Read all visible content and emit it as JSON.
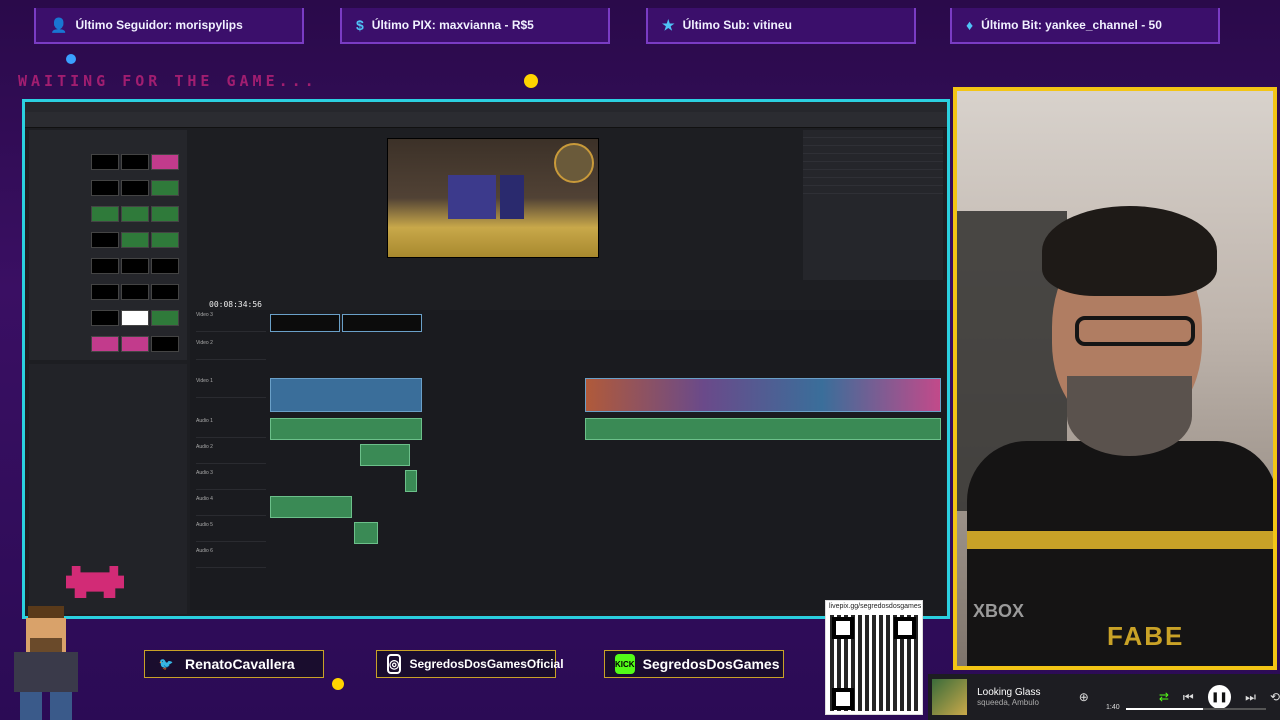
{
  "alerts": {
    "follower": "Último Seguidor: morispylips",
    "pix": "Último PIX: maxvianna - R$5",
    "sub": "Último Sub: vitineu",
    "bit": "Último Bit: yankee_channel - 50"
  },
  "waiting_text": "WAITING FOR THE GAME...",
  "editor": {
    "timecode": "00:08:34:56",
    "tracks": [
      "Video 3",
      "Video 2",
      "Video 1",
      "Audio 1",
      "Audio 2",
      "Audio 3",
      "Audio 4",
      "Audio 5",
      "Audio 6"
    ]
  },
  "social": {
    "twitter": "RenatoCavallera",
    "instagram": "SegredosDosGamesOficial",
    "kick_badge": "KICK",
    "kick": "SegredosDosGames"
  },
  "qr": {
    "url": "livepix.gg/segredosdosgames"
  },
  "music": {
    "title": "Looking Glass",
    "artist": "squeeda, Ambulo",
    "time": "1:40",
    "progress": 0.55
  },
  "webcam": {
    "shirt_logo": "XBOX",
    "shirt_text": "FABE"
  },
  "colors": {
    "accent_cyan": "#2bd0e0",
    "accent_yellow": "#f3c515",
    "bg_purple": "#3a0f63"
  }
}
